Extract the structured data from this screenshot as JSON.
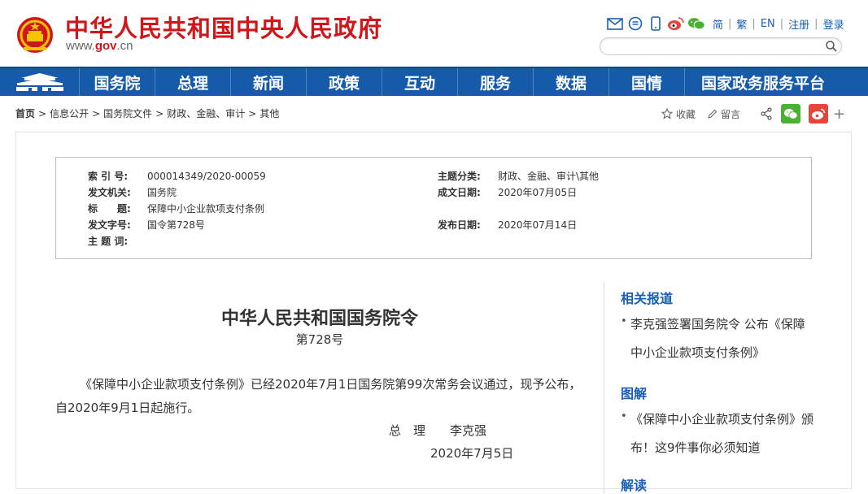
{
  "header": {
    "site_title": "中华人民共和国中央人民政府",
    "domain_prefix": "www.",
    "domain_mid": "gov",
    "domain_suffix": ".cn",
    "top_links": [
      "简",
      "繁",
      "EN",
      "注册",
      "登录"
    ],
    "search_placeholder": "",
    "icons": [
      "mail-icon",
      "chat-icon",
      "mobile-icon",
      "weibo-icon",
      "wechat-icon"
    ]
  },
  "nav": {
    "items": [
      "国务院",
      "总理",
      "新闻",
      "政策",
      "互动",
      "服务",
      "数据",
      "国情",
      "国家政务服务平台"
    ]
  },
  "breadcrumb": {
    "items": [
      "首页",
      "信息公开",
      "国务院文件",
      "财政、金融、审计",
      "其他"
    ],
    "separator": ">"
  },
  "actions": {
    "favorite": "收藏",
    "comment": "留言",
    "more": "+"
  },
  "meta": {
    "index_no_label": "索 引 号:",
    "index_no": "000014349/2020-00059",
    "issuer_label": "发文机关:",
    "issuer": "国务院",
    "title_label": "标　　题:",
    "title": "保障中小企业款项支付条例",
    "doc_no_label": "发文字号:",
    "doc_no": "国令第728号",
    "keywords_label": "主 题 词:",
    "keywords": "",
    "category_label": "主题分类:",
    "category": "财政、金融、审计\\其他",
    "written_label": "成文日期:",
    "written": "2020年07月05日",
    "published_label": "发布日期:",
    "published": "2020年07月14日"
  },
  "article": {
    "title": "中华人民共和国国务院令",
    "number": "第728号",
    "body": "《保障中小企业款项支付条例》已经2020年7月1日国务院第99次常务会议通过，现予公布，自2020年9月1日起施行。",
    "signature": "总　理　　李克强",
    "date": "2020年7月5日"
  },
  "sidebar": {
    "related_heading": "相关报道",
    "related_items": [
      "李克强签署国务院令 公布《保障中小企业款项支付条例》"
    ],
    "graphic_heading": "图解",
    "graphic_items": [
      "《保障中小企业款项支付条例》颁布！这9件事你必须知道"
    ],
    "next_heading": "解读"
  },
  "colors": {
    "brand_red": "#d0161b",
    "nav_blue": "#155ba9",
    "link_blue": "#1a5fb4",
    "wechat_green": "#4cb034",
    "weibo_red": "#e6453b"
  }
}
